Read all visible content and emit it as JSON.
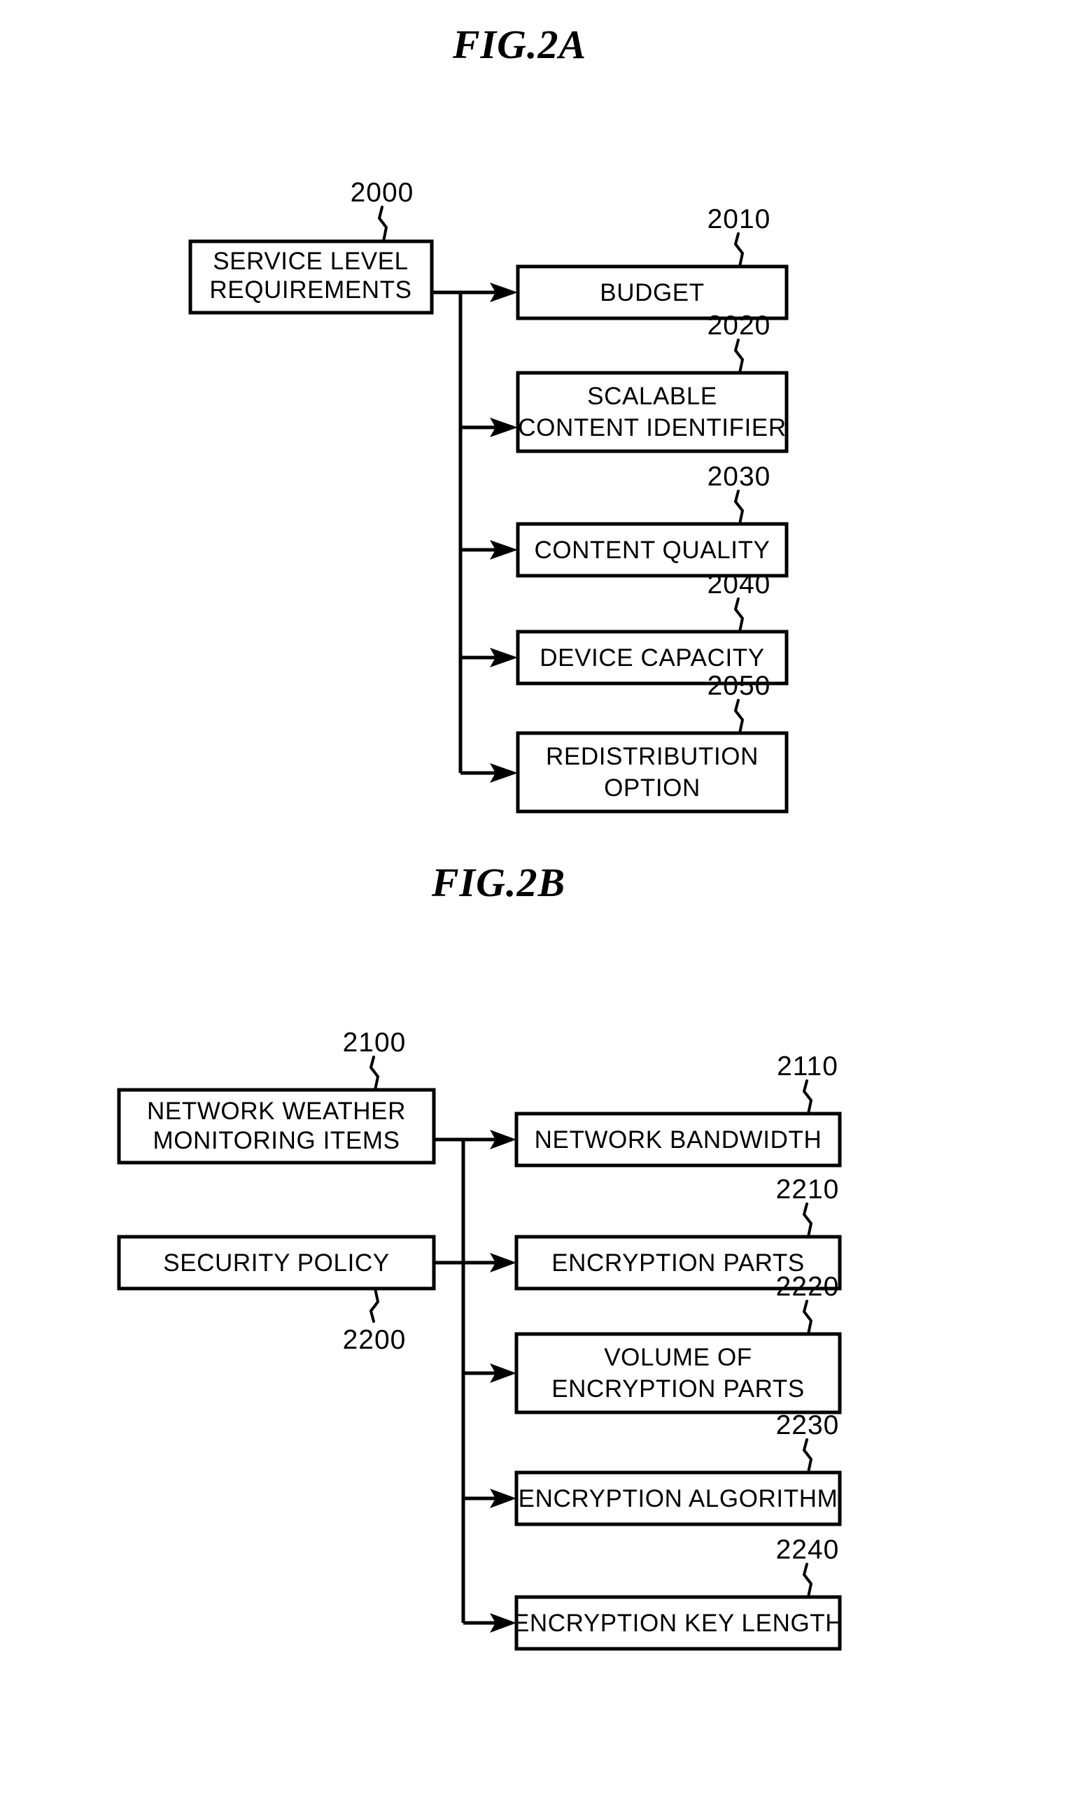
{
  "figures": [
    {
      "title": "FIG.2A",
      "source": {
        "ref": "2000",
        "lines": [
          "SERVICE LEVEL",
          "REQUIREMENTS"
        ]
      },
      "items": [
        {
          "ref": "2010",
          "lines": [
            "BUDGET"
          ]
        },
        {
          "ref": "2020",
          "lines": [
            "SCALABLE",
            "CONTENT IDENTIFIER"
          ]
        },
        {
          "ref": "2030",
          "lines": [
            "CONTENT QUALITY"
          ]
        },
        {
          "ref": "2040",
          "lines": [
            "DEVICE CAPACITY"
          ]
        },
        {
          "ref": "2050",
          "lines": [
            "REDISTRIBUTION",
            "OPTION"
          ]
        }
      ]
    },
    {
      "title": "FIG.2B",
      "sources": [
        {
          "ref": "2100",
          "lines": [
            "NETWORK WEATHER",
            "MONITORING ITEMS"
          ]
        },
        {
          "ref": "2200",
          "lines": [
            "SECURITY POLICY"
          ]
        }
      ],
      "items": [
        {
          "ref": "2110",
          "lines": [
            "NETWORK BANDWIDTH"
          ]
        },
        {
          "ref": "2210",
          "lines": [
            "ENCRYPTION PARTS"
          ]
        },
        {
          "ref": "2220",
          "lines": [
            "VOLUME OF",
            "ENCRYPTION PARTS"
          ]
        },
        {
          "ref": "2230",
          "lines": [
            "ENCRYPTION ALGORITHM"
          ]
        },
        {
          "ref": "2240",
          "lines": [
            "ENCRYPTION KEY LENGTH"
          ]
        }
      ]
    }
  ]
}
